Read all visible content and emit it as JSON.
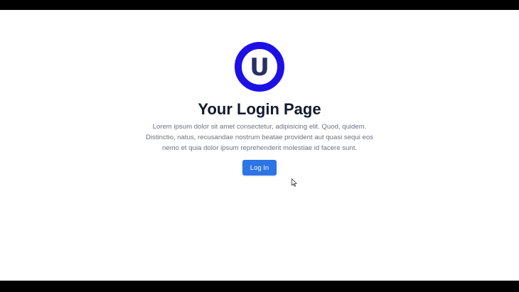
{
  "logo": {
    "letter": "U",
    "ring_color": "#1c10e6",
    "letter_color": "#2a2f63"
  },
  "hero": {
    "title": "Your Login Page",
    "description": "Lorem ipsum dolor sit amet consectetur, adipisicing elit. Quod, quidem. Distinctio, natus, recusandae nostrum beatae provident aut quasi sequi eos nemo et quia dolor ipsum reprehenderit molestiae id facere sunt."
  },
  "login_button": {
    "label": "Log In",
    "color": "#2d74e6"
  },
  "cursor": {
    "icon": "mouse-pointer-icon"
  }
}
